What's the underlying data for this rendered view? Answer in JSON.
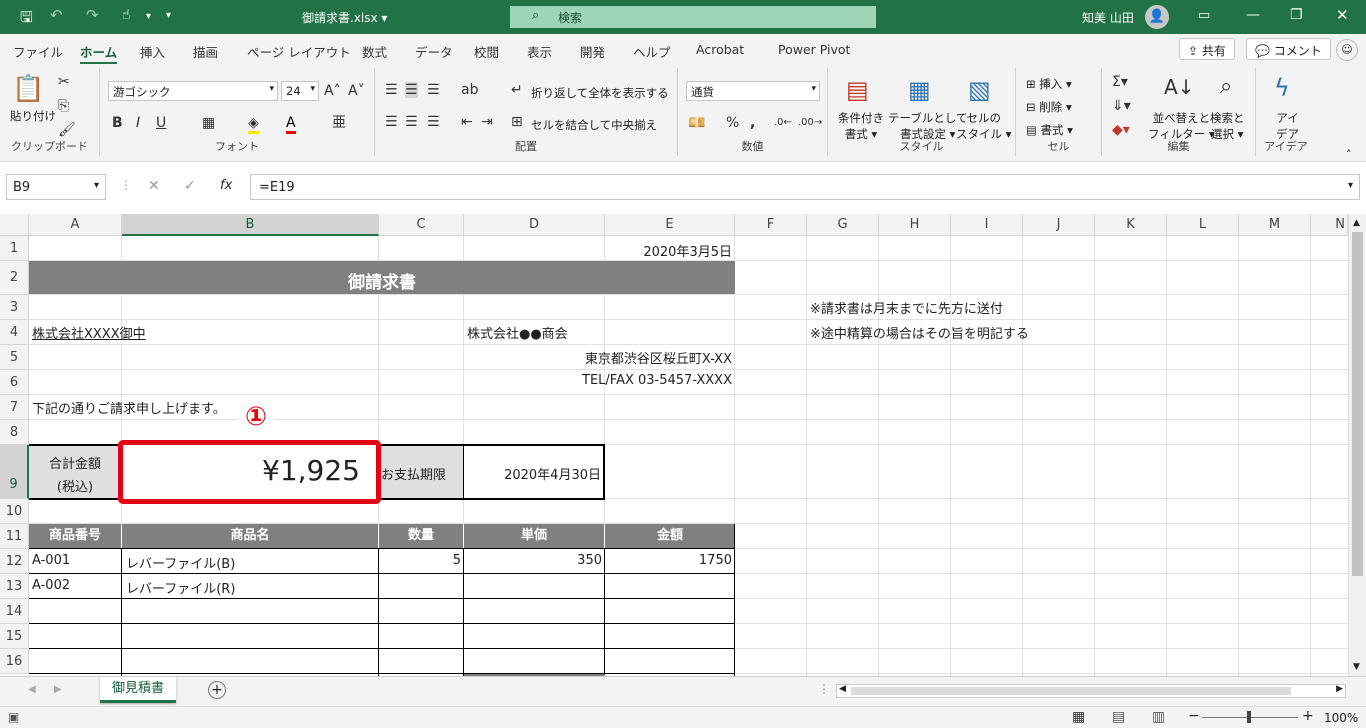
{
  "titlebar": {
    "filename": "御請求書.xlsx",
    "search_placeholder": "検索",
    "user": "知美 山田",
    "avatar_text": "👤"
  },
  "menu": {
    "items": [
      "ファイル",
      "ホーム",
      "挿入",
      "描画",
      "ページ レイアウト",
      "数式",
      "データ",
      "校閲",
      "表示",
      "開発",
      "ヘルプ",
      "Acrobat",
      "Power Pivot"
    ],
    "active": "ホーム",
    "share": "共有",
    "comment": "コメント"
  },
  "ribbon": {
    "clipboard": {
      "paste": "貼り付け",
      "label": "クリップボード"
    },
    "font": {
      "name": "游ゴシック",
      "size": "24",
      "label": "フォント"
    },
    "align": {
      "wrap": "折り返して全体を表示する",
      "merge": "セルを結合して中央揃え",
      "label": "配置"
    },
    "number": {
      "format": "通貨",
      "label": "数値"
    },
    "style": {
      "cond": "条件付き",
      "cond2": "書式",
      "table": "テーブルとして",
      "table2": "書式設定",
      "cell": "セルの",
      "cell2": "スタイル",
      "label": "スタイル"
    },
    "cells": {
      "insert": "挿入",
      "delete": "削除",
      "format": "書式",
      "label": "セル"
    },
    "edit": {
      "sort": "並べ替えと",
      "sort2": "フィルター",
      "find": "検索と",
      "find2": "選択",
      "label": "編集"
    },
    "ideas": {
      "name": "アイ",
      "name2": "デア",
      "label": "アイデア"
    }
  },
  "formula_bar": {
    "name_box": "B9",
    "formula": "=E19"
  },
  "columns": [
    "A",
    "B",
    "C",
    "D",
    "E",
    "F",
    "G",
    "H",
    "I",
    "J",
    "K",
    "L",
    "M",
    "N"
  ],
  "rows": [
    "1",
    "2",
    "3",
    "4",
    "5",
    "6",
    "7",
    "8",
    "9",
    "10",
    "11",
    "12",
    "13",
    "14",
    "15",
    "16"
  ],
  "cells": {
    "e1": "2020年3月5日",
    "title": "御請求書",
    "g3": "※請求書は月末までに先方に送付",
    "a4": "株式会社XXXX御中",
    "d4": "株式会社●●商会",
    "e5": "東京都渋谷区桜丘町X-XX",
    "e6": "TEL/FAX 03-5457-XXXX",
    "g4": "※途中精算の場合はその旨を明記する",
    "a7": "下記の通りご請求申し上げます。",
    "a9_1": "合計金額",
    "a9_2": "(税込)",
    "b9": "¥1,925",
    "c9": "お支払期限",
    "d9": "2020年4月30日",
    "table_headers": [
      "商品番号",
      "商品名",
      "数量",
      "単価",
      "金額"
    ],
    "r12": [
      "A-001",
      "レバーファイル(B)",
      "5",
      "350",
      "1750"
    ],
    "r13": [
      "A-002",
      "レバーファイル(R)",
      "",
      "",
      ""
    ]
  },
  "callout": "①",
  "sheet_tabs": [
    "御見積書"
  ],
  "status": {
    "zoom": "100%"
  },
  "colors": {
    "excel_green": "#217346",
    "callout_red": "#e60012",
    "header_gray": "#808080"
  }
}
